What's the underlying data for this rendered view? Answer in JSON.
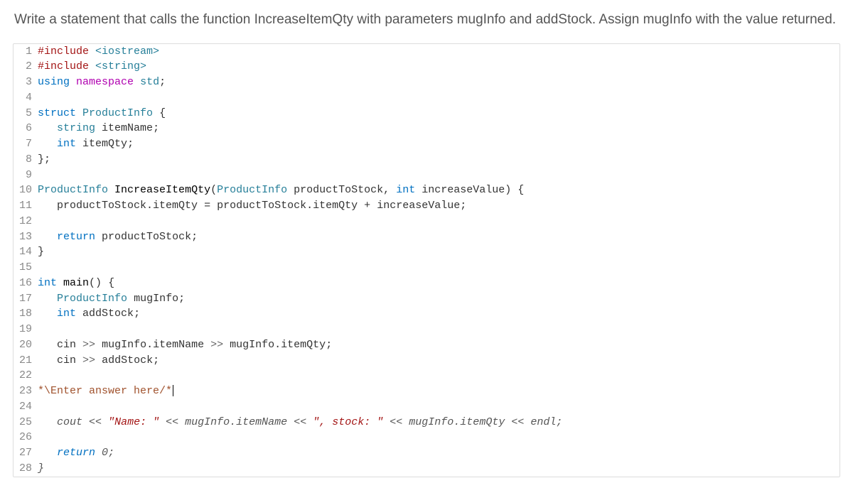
{
  "question": "Write a statement that calls the function IncreaseItemQty with parameters mugInfo and addStock. Assign mugInfo with the value returned.",
  "code": {
    "l1": {
      "include": "#include",
      "hdr": "<iostream>"
    },
    "l2": {
      "include": "#include",
      "hdr": "<string>"
    },
    "l3": {
      "using": "using",
      "ns": "namespace",
      "std": "std",
      "semi": ";"
    },
    "l4": "",
    "l5": {
      "kw": "struct",
      "name": "ProductInfo",
      "brace": "{"
    },
    "l6": {
      "indent": "   ",
      "type": "string",
      "name": "itemName",
      "semi": ";"
    },
    "l7": {
      "indent": "   ",
      "type": "int",
      "name": "itemQty",
      "semi": ";"
    },
    "l8": {
      "brace": "};"
    },
    "l9": "",
    "l10": {
      "ret": "ProductInfo",
      "fn": "IncreaseItemQty",
      "p1t": "ProductInfo",
      "p1n": "productToStock",
      "p2t": "int",
      "p2n": "increaseValue",
      "brace": "{"
    },
    "l11": {
      "indent": "   ",
      "lhs": "productToStock.itemQty",
      "eq": "=",
      "rhs1": "productToStock.itemQty",
      "plus": "+",
      "rhs2": "increaseValue",
      "semi": ";"
    },
    "l12": "",
    "l13": {
      "indent": "   ",
      "kw": "return",
      "expr": "productToStock",
      "semi": ";"
    },
    "l14": {
      "brace": "}"
    },
    "l15": "",
    "l16": {
      "ret": "int",
      "fn": "main",
      "args": "()",
      "brace": "{"
    },
    "l17": {
      "indent": "   ",
      "type": "ProductInfo",
      "name": "mugInfo",
      "semi": ";"
    },
    "l18": {
      "indent": "   ",
      "type": "int",
      "name": "addStock",
      "semi": ";"
    },
    "l19": "",
    "l20": {
      "indent": "   ",
      "cin": "cin",
      "op1": ">>",
      "a1": "mugInfo.itemName",
      "op2": ">>",
      "a2": "mugInfo.itemQty",
      "semi": ";"
    },
    "l21": {
      "indent": "   ",
      "cin": "cin",
      "op1": ">>",
      "a1": "addStock",
      "semi": ";"
    },
    "l22": "",
    "l23": {
      "prefix": "*\\",
      "text": "Enter answer here",
      "suffix": "/*"
    },
    "l24": "",
    "l25": {
      "indent": "   ",
      "cout": "cout",
      "op1": "<<",
      "s1": "\"Name: \"",
      "op2": "<<",
      "e1": "mugInfo.itemName",
      "op3": "<<",
      "s2": "\", stock: \"",
      "op4": "<<",
      "e2": "mugInfo.itemQty",
      "op5": "<<",
      "endl": "endl",
      "semi": ";"
    },
    "l26": "",
    "l27": {
      "indent": "   ",
      "kw": "return",
      "val": "0",
      "semi": ";"
    },
    "l28": {
      "brace": "}"
    }
  },
  "line_numbers": [
    "1",
    "2",
    "3",
    "4",
    "5",
    "6",
    "7",
    "8",
    "9",
    "10",
    "11",
    "12",
    "13",
    "14",
    "15",
    "16",
    "17",
    "18",
    "19",
    "20",
    "21",
    "22",
    "23",
    "24",
    "25",
    "26",
    "27",
    "28"
  ]
}
